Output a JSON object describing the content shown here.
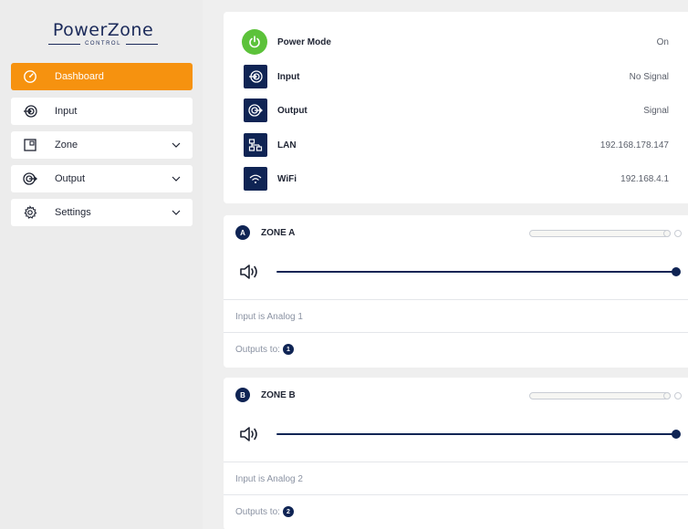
{
  "brand": {
    "name": "PowerZone",
    "sub": "CONTROL"
  },
  "sidebar": {
    "items": [
      {
        "label": "Dashboard",
        "icon": "gauge-icon",
        "active": true,
        "expandable": false
      },
      {
        "label": "Input",
        "icon": "input-target-icon",
        "active": false,
        "expandable": false
      },
      {
        "label": "Zone",
        "icon": "zone-square-icon",
        "active": false,
        "expandable": true
      },
      {
        "label": "Output",
        "icon": "output-target-icon",
        "active": false,
        "expandable": true
      },
      {
        "label": "Settings",
        "icon": "gear-icon",
        "active": false,
        "expandable": true
      }
    ]
  },
  "status": {
    "power": {
      "label": "Power Mode",
      "value": "On"
    },
    "input": {
      "label": "Input",
      "value": "No Signal"
    },
    "output": {
      "label": "Output",
      "value": "Signal"
    },
    "lan": {
      "label": "LAN",
      "value": "192.168.178.147"
    },
    "wifi": {
      "label": "WiFi",
      "value": "192.168.4.1"
    }
  },
  "zones": [
    {
      "badge": "A",
      "title": "ZONE A",
      "volume": 1.0,
      "input_text": "Input is Analog 1",
      "outputs_label": "Outputs to:",
      "output_badge": "1"
    },
    {
      "badge": "B",
      "title": "ZONE B",
      "volume": 1.0,
      "input_text": "Input is Analog 2",
      "outputs_label": "Outputs to:",
      "output_badge": "2"
    }
  ],
  "colors": {
    "accent": "#f6920f",
    "navy": "#0f2454",
    "power_green": "#5cc23a"
  }
}
